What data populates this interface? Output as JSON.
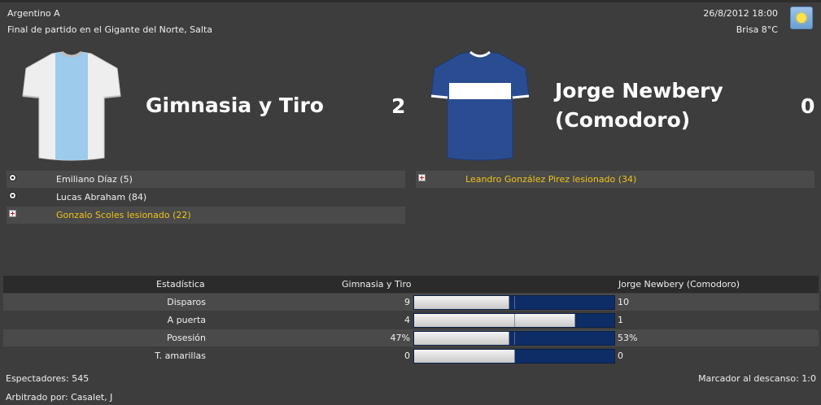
{
  "header": {
    "competition": "Argentino A",
    "venue": "Final de partido en el Gigante del Norte, Salta",
    "datetime": "26/8/2012 18:00",
    "weather": "Brisa 8°C",
    "weather_icon": "sun-icon"
  },
  "home": {
    "name": "Gimnasia y Tiro",
    "score": "2",
    "kit_colors": {
      "body": "#eeeeee",
      "stripe": "#9ccbec"
    },
    "events": [
      {
        "type": "goal",
        "text": "Emiliano Díaz (5)"
      },
      {
        "type": "goal",
        "text": "Lucas Abraham (84)"
      },
      {
        "type": "injury",
        "text": "Gonzalo Scoles lesionado (22)"
      }
    ]
  },
  "away": {
    "name_line1": "Jorge Newbery",
    "name_line2": "(Comodoro)",
    "score": "0",
    "kit_colors": {
      "body": "#2a4d92",
      "band": "#ffffff"
    },
    "events": [
      {
        "type": "injury",
        "text": "Leandro González Pirez lesionado (34)"
      }
    ]
  },
  "stats": {
    "header_label": "Estadística",
    "home_team": "Gimnasia y Tiro",
    "away_team": "Jorge Newbery (Comodoro)",
    "rows": [
      {
        "label": "Disparos",
        "home": "9",
        "away": "10",
        "home_share": 0.47
      },
      {
        "label": "A puerta",
        "home": "4",
        "away": "1",
        "home_share": 0.8
      },
      {
        "label": "Posesión",
        "home": "47%",
        "away": "53%",
        "home_share": 0.47
      },
      {
        "label": "T. amarillas",
        "home": "0",
        "away": "0",
        "home_share": 0.5
      }
    ]
  },
  "footer": {
    "attendance": "Espectadores: 545",
    "referee": "Arbitrado por: Casalet, J",
    "halftime": "Marcador al descanso: 1:0"
  }
}
